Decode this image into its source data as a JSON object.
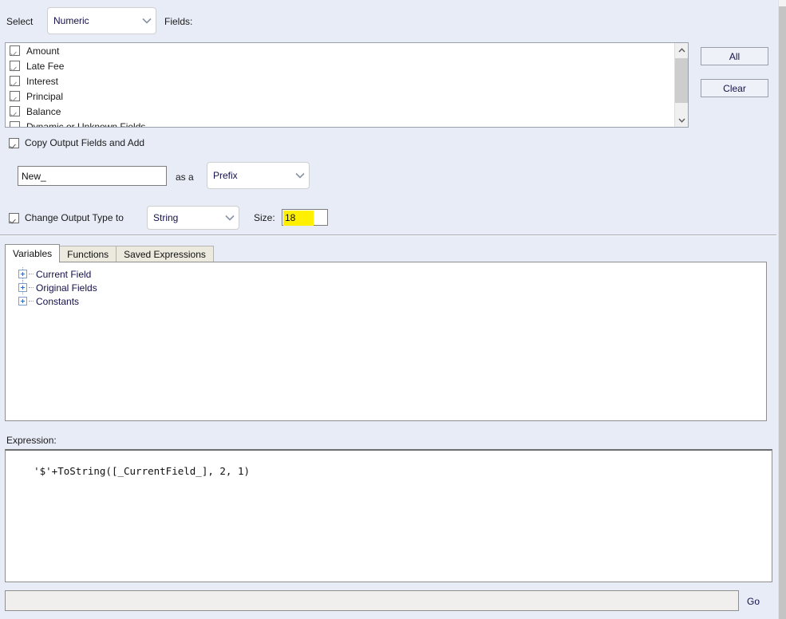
{
  "top": {
    "select_label": "Select",
    "type_filter": "Numeric",
    "fields_label": "Fields:"
  },
  "field_list": {
    "items": [
      {
        "label": "Amount",
        "checked": true
      },
      {
        "label": "Late Fee",
        "checked": true
      },
      {
        "label": "Interest",
        "checked": true
      },
      {
        "label": "Principal",
        "checked": true
      },
      {
        "label": "Balance",
        "checked": true
      },
      {
        "label": "Dynamic or Unknown Fields",
        "checked": false
      }
    ]
  },
  "buttons": {
    "all": "All",
    "clear": "Clear"
  },
  "copy_output": {
    "checkbox_label": "Copy Output Fields and Add",
    "checked": true,
    "name_value": "New_",
    "as_a_label": "as a",
    "affix_mode": "Prefix"
  },
  "change_type": {
    "checkbox_label": "Change Output Type to",
    "checked": true,
    "type_value": "String",
    "size_label": "Size:",
    "size_value": "18"
  },
  "tabs": [
    {
      "label": "Variables",
      "active": true
    },
    {
      "label": "Functions",
      "active": false
    },
    {
      "label": "Saved Expressions",
      "active": false
    }
  ],
  "tree": {
    "items": [
      {
        "label": "Current Field"
      },
      {
        "label": "Original Fields"
      },
      {
        "label": "Constants"
      }
    ]
  },
  "expression": {
    "label": "Expression:",
    "value": "'$'+ToString([_CurrentField_], 2, 1)"
  },
  "status_bar": {
    "input_value": "",
    "go_label": "Go"
  },
  "colors": {
    "background": "#e8ecf7",
    "highlight": "#ffef00",
    "text_blue": "#14104a"
  }
}
